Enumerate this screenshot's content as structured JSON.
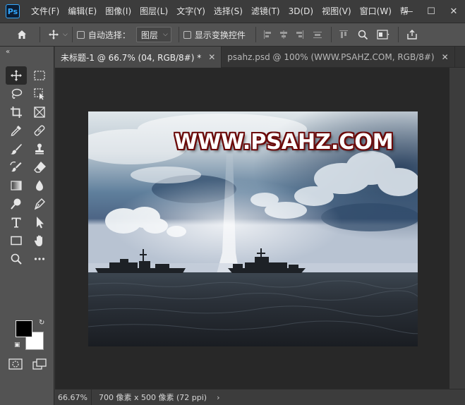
{
  "app": {
    "logo": "Ps"
  },
  "menu": [
    "文件(F)",
    "编辑(E)",
    "图像(I)",
    "图层(L)",
    "文字(Y)",
    "选择(S)",
    "滤镜(T)",
    "3D(D)",
    "视图(V)",
    "窗口(W)",
    "帮"
  ],
  "window_controls": {
    "minimize": "—",
    "maximize": "☐",
    "close": "✕"
  },
  "options": {
    "auto_select_label": "自动选择：",
    "layer_select_value": "图层",
    "show_transform_label": "显示变换控件"
  },
  "tabs": [
    {
      "label": "未标题-1 @ 66.7% (04, RGB/8#) *",
      "active": true
    },
    {
      "label": "psahz.psd @ 100% (WWW.PSAHZ.COM, RGB/8#)",
      "active": false
    }
  ],
  "canvas": {
    "watermark_text": "WWW.PSAHZ.COM"
  },
  "status": {
    "zoom": "66.67%",
    "doc_info": "700 像素 x 500 像素 (72 ppi)",
    "arrow": "›"
  },
  "colors": {
    "foreground": "#000000",
    "background": "#ffffff",
    "accent": "#31a8ff"
  },
  "toolbar_icons": [
    "move-icon",
    "marquee-icon",
    "lasso-icon",
    "object-select-icon",
    "crop-icon",
    "frame-icon",
    "eyedropper-icon",
    "spot-healing-icon",
    "brush-icon",
    "stamp-icon",
    "history-brush-icon",
    "eraser-icon",
    "gradient-icon",
    "blur-drop-icon",
    "dodge-icon",
    "pen-icon",
    "type-icon",
    "path-select-icon",
    "rectangle-icon",
    "hand-icon",
    "zoom-icon",
    "more-tools-icon"
  ]
}
